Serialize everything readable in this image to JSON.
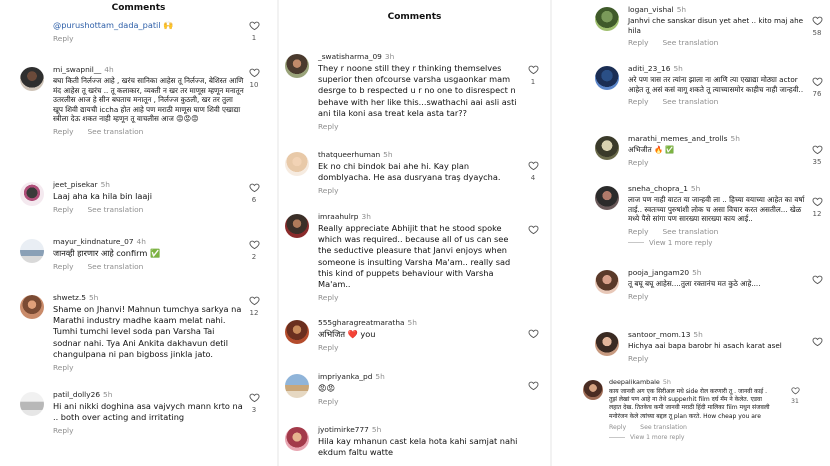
{
  "panels": [
    {
      "title": "Comments",
      "top_fragment": {
        "text": "@purushottam_dada_patil 🙌",
        "reply": "Reply",
        "likes": "1"
      },
      "comments": [
        {
          "user": "mi_swapnil__",
          "time": "4h",
          "text": "बघा किती निर्लज्ज आहे , खरंच सानिका आहेस तू निर्लज्ज, बेशिस्त आणि मंद आहेस तू खरंच .. तू कलाकार, व्यक्ती न खर तर माणूस म्हणून मनातून उतरलीस आज हे सीन बघताच मनातून , निर्लज्ज कुठली, खर तर तुला खूप शिवी द्यायची iccha होत आहे पण मराठी माणूस घाण शिवी एखाद्या स्त्रीला देऊ शकत नाही म्हणून तू वाचलीस आज 😡😡😡",
          "reply": "Reply",
          "translate": "See translation",
          "likes": "10"
        },
        {
          "user": "jeet_pisekar",
          "time": "5h",
          "text": "Laaj aha ka hila bin laaji",
          "reply": "Reply",
          "translate": "See translation",
          "likes": "6"
        },
        {
          "user": "mayur_kindnature_07",
          "time": "4h",
          "text": "जानव्ही हारणार आहे confirm ✅",
          "reply": "Reply",
          "translate": "See translation",
          "likes": "2"
        },
        {
          "user": "shwetz.5",
          "time": "5h",
          "text": "Shame on Jhanvi! Mahnun tumchya sarkya na Marathi industry madhe kaam melat nahi. Tumhi tumchi level soda pan Varsha Tai sodnar nahi. Tya Ani Ankita dakhavun detil changulpana ni pan bigboss jinkla jato.",
          "reply": "Reply",
          "translate": "",
          "likes": "12"
        },
        {
          "user": "patil_dolly26",
          "time": "5h",
          "text": "Hi ani nikki doghina asa vajvych mann krto na .. both over acting and irritating",
          "reply": "Reply",
          "translate": "",
          "likes": "3"
        }
      ]
    },
    {
      "title": "Comments",
      "comments": [
        {
          "user": "_swatisharma_09",
          "time": "3h",
          "text": "They r noone still they r thinking themselves superior then ofcourse varsha usgaonkar mam desrge to b respected u r no one to disrespect n behave with her like this...swathachi aai asli asti ani tila koni asa treat kela asta tar??",
          "reply": "Reply",
          "translate": "",
          "likes": "1"
        },
        {
          "user": "thatqueerhuman",
          "time": "5h",
          "text": "Ek no chi bindok bai ahe hi. Kay plan domblyacha. He asa dusryana traş dyaycha.",
          "reply": "Reply",
          "translate": "",
          "likes": "4"
        },
        {
          "user": "imraahulrp",
          "time": "3h",
          "text": "Really appreciate Abhijit that he stood spoke which was required.. because all of us can see the seductive pleasure that Janvi enjoys when someone is insulting Varsha Ma'am.. really sad this kind of puppets behaviour with Varsha Ma'am..",
          "reply": "Reply",
          "translate": "",
          "likes": ""
        },
        {
          "user": "555gharagreatmaratha",
          "time": "5h",
          "text": "अभिजित ❤️ you",
          "reply": "Reply",
          "translate": "",
          "likes": ""
        },
        {
          "user": "impriyanka_pd",
          "time": "5h",
          "text": "😡😡",
          "reply": "Reply",
          "translate": "",
          "likes": ""
        },
        {
          "user": "jyotimirke777",
          "time": "5h",
          "text": "Hila kay mhanun cast kela hota kahi samjat nahi ekdum faltu watte",
          "reply": "",
          "translate": "",
          "likes": ""
        }
      ]
    },
    {
      "title": "",
      "comments": [
        {
          "user": "logan_vishal",
          "time": "5h",
          "text": "Janhvi che sanskar disun yet ahet .. kito maj ahe hila",
          "reply": "Reply",
          "translate": "See translation",
          "likes": "58",
          "view_replies": ""
        },
        {
          "user": "aditi_23_16",
          "time": "5h",
          "text": "अरे पण त्रास तर त्यांना झाला ना आणि त्या एखाद्या मोठ्या actor आहेत तू असं कसं वागू शकते तू त्याच्यासमोर काहीच नाही जान्हवी..",
          "reply": "Reply",
          "translate": "See translation",
          "likes": "76",
          "view_replies": ""
        },
        {
          "user": "marathi_memes_and_trolls",
          "time": "5h",
          "text": "अभिजीत 🔥 ✅",
          "reply": "Reply",
          "translate": "",
          "likes": "35",
          "view_replies": ""
        },
        {
          "user": "sneha_chopra_1",
          "time": "5h",
          "text": "लाज पण नाही वाटत या जान्हवी ला .. हिच्या वयाच्या आहेत का वर्षा ताई.. स्वतःच्या पुरुषांशी लोक च असा विचार करत असतील... खेळ मध्ये पैसे सांगा पण सारख्या सारख्या काय आई..",
          "reply": "Reply",
          "translate": "See translation",
          "likes": "12",
          "view_replies": "View 1 more reply"
        },
        {
          "user": "pooja_jangam20",
          "time": "5h",
          "text": "तू बघू बघू आहेस....तुला रक्तानंच मत कुठे आहे....",
          "reply": "Reply",
          "translate": "",
          "likes": "",
          "view_replies": ""
        },
        {
          "user": "santoor_mom.13",
          "time": "5h",
          "text": "Hichya aai bapa barobr hi asach karat asel",
          "reply": "Reply",
          "translate": "",
          "likes": "",
          "view_replies": ""
        },
        {
          "user": "deepalikambale",
          "time": "5h",
          "text": "काय जानवी अग एक सिरीअल मधे side रोल करणारी तू . जानवी काई . तुझं लेखां पण आहे ना तेथे supperhit film दर्घ मॅम ने केलेत. एडवा लहात देख. तितकेच कमी जानवी मराठी हिंदी मालिका film मधुन संजवली मनोरंजन केले त्यांच्या बद्दल तू plan करते. How cheap you are",
          "reply": "Reply",
          "translate": "See translation",
          "likes": "31",
          "view_replies": "View 1 more reply"
        }
      ]
    }
  ]
}
